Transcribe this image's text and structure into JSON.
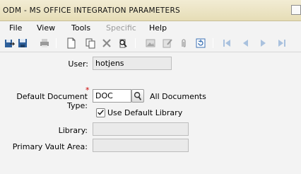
{
  "window": {
    "title": "ODM - MS OFFICE INTEGRATION PARAMETERS"
  },
  "menu": [
    {
      "label": "File",
      "enabled": true
    },
    {
      "label": "View",
      "enabled": true
    },
    {
      "label": "Tools",
      "enabled": true
    },
    {
      "label": "Specific",
      "enabled": false
    },
    {
      "label": "Help",
      "enabled": true
    }
  ],
  "toolbar": [
    "save-and-exit-icon",
    "save-icon",
    "print-icon",
    "new-record-icon",
    "copy-record-icon",
    "delete-record-icon",
    "search-icon",
    "image-icon",
    "attachment-icon",
    "paperclip-icon",
    "refresh-icon",
    "first-record-icon",
    "previous-record-icon",
    "next-record-icon",
    "last-record-icon"
  ],
  "form": {
    "user_label": "User:",
    "user_value": "hotjens",
    "doc_type_label": "Default Document Type:",
    "doc_type_value": "DOC",
    "doc_type_desc": "All Documents",
    "use_default_library_label": "Use Default Library",
    "use_default_library_checked": true,
    "library_label": "Library:",
    "library_value": "",
    "vault_label": "Primary Vault Area:",
    "vault_value": ""
  },
  "colors": {
    "titlebar": "#e9e1bf",
    "required": "#cc0000",
    "toolbar_icon_blue": "#3c72b4"
  }
}
